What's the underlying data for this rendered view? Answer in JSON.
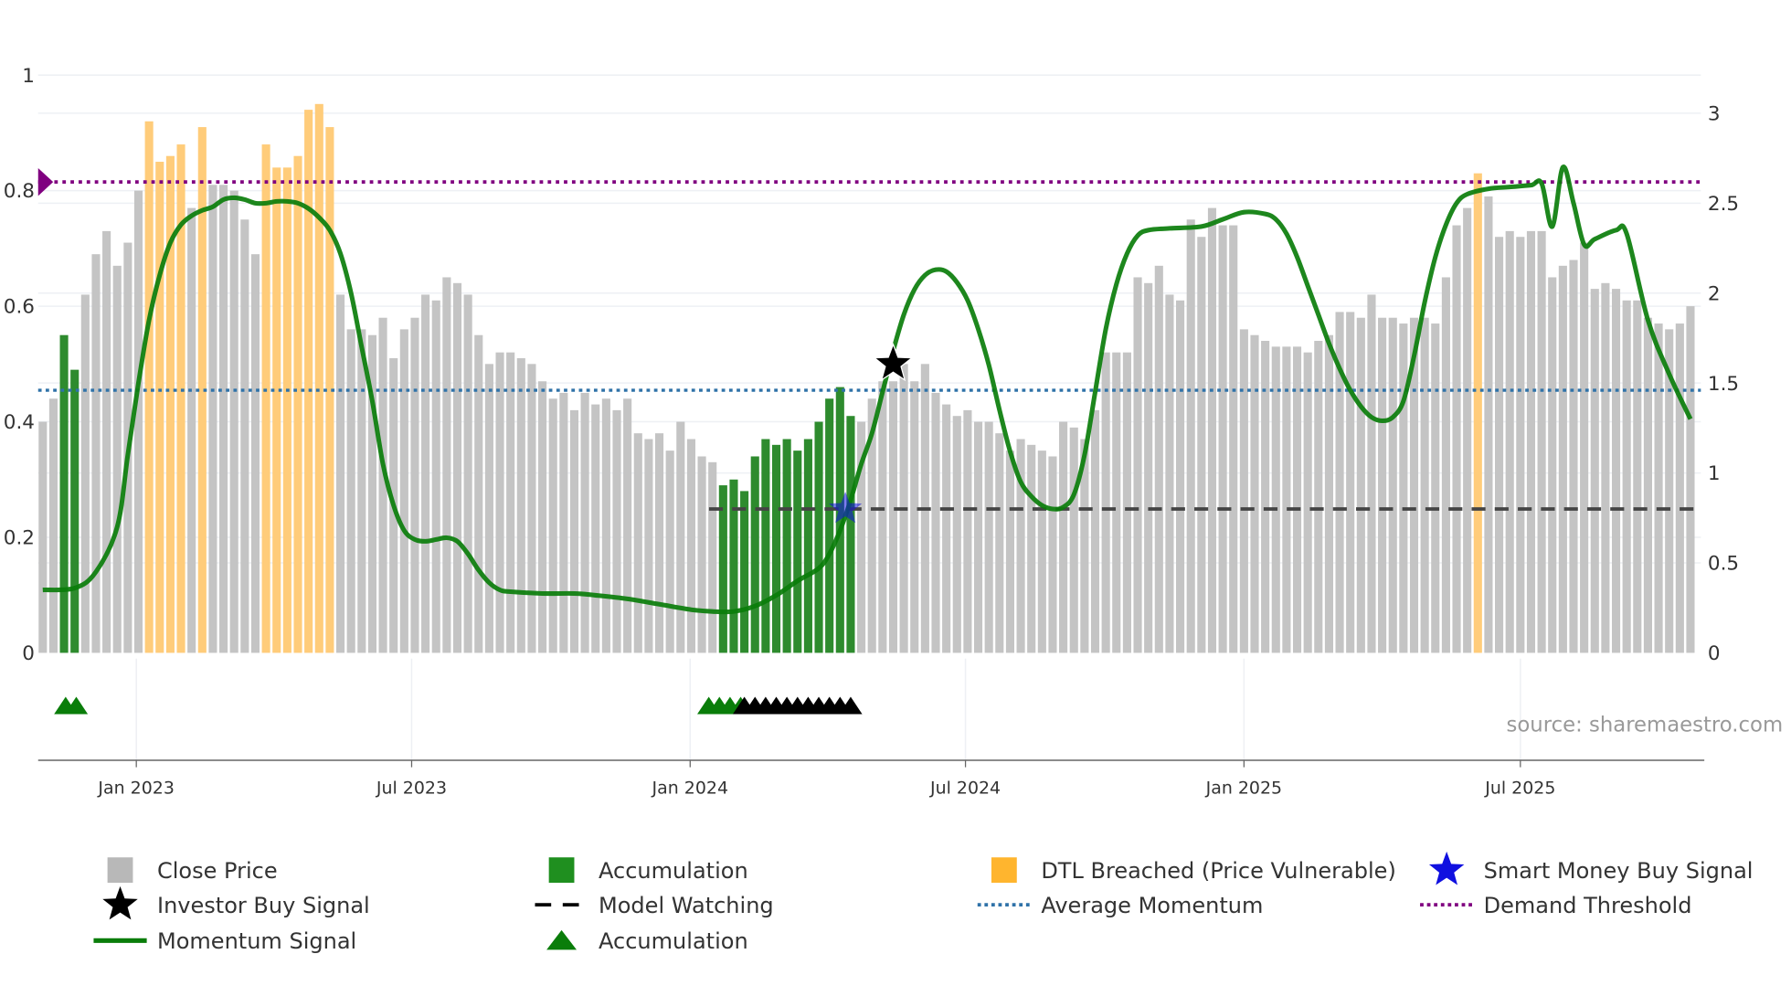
{
  "chart_data": {
    "type": "bar",
    "title": "",
    "x_unit": "week",
    "x_ticks": [
      {
        "label": "Jan 2023",
        "week": 8.8
      },
      {
        "label": "Jul 2023",
        "week": 34.7
      },
      {
        "label": "Jan 2024",
        "week": 60.9
      },
      {
        "label": "Jul 2024",
        "week": 86.8
      },
      {
        "label": "Jan 2025",
        "week": 113
      },
      {
        "label": "Jul 2025",
        "week": 139
      }
    ],
    "left_axis": {
      "ylim": [
        0,
        1
      ],
      "ticks": [
        "0",
        "0.2",
        "0.4",
        "0.6",
        "0.8",
        "1"
      ],
      "tick_values": [
        0,
        0.2,
        0.4,
        0.6,
        0.8,
        1
      ]
    },
    "right_axis": {
      "ylim": [
        0,
        3
      ],
      "ticks": [
        "0",
        "0.5",
        "1",
        "1.5",
        "2",
        "2.5",
        "3"
      ],
      "tick_values": [
        0,
        0.5,
        1,
        1.5,
        2,
        2.5,
        3
      ]
    },
    "close_price": [
      0.4,
      0.44,
      0.55,
      0.49,
      0.62,
      0.69,
      0.73,
      0.67,
      0.71,
      0.8,
      0.92,
      0.85,
      0.86,
      0.88,
      0.77,
      0.91,
      0.81,
      0.81,
      0.8,
      0.75,
      0.69,
      0.88,
      0.84,
      0.84,
      0.86,
      0.94,
      0.95,
      0.91,
      0.62,
      0.56,
      0.56,
      0.55,
      0.58,
      0.51,
      0.56,
      0.58,
      0.62,
      0.61,
      0.65,
      0.64,
      0.62,
      0.55,
      0.5,
      0.52,
      0.52,
      0.51,
      0.5,
      0.47,
      0.44,
      0.45,
      0.42,
      0.45,
      0.43,
      0.44,
      0.42,
      0.44,
      0.38,
      0.37,
      0.38,
      0.35,
      0.4,
      0.37,
      0.34,
      0.33,
      0.29,
      0.3,
      0.28,
      0.34,
      0.37,
      0.36,
      0.37,
      0.35,
      0.37,
      0.4,
      0.44,
      0.46,
      0.41,
      0.4,
      0.44,
      0.47,
      0.47,
      0.5,
      0.47,
      0.5,
      0.45,
      0.43,
      0.41,
      0.42,
      0.4,
      0.4,
      0.38,
      0.35,
      0.37,
      0.36,
      0.35,
      0.34,
      0.4,
      0.39,
      0.37,
      0.42,
      0.52,
      0.52,
      0.52,
      0.65,
      0.64,
      0.67,
      0.62,
      0.61,
      0.75,
      0.72,
      0.77,
      0.74,
      0.74,
      0.56,
      0.55,
      0.54,
      0.53,
      0.53,
      0.53,
      0.52,
      0.54,
      0.55,
      0.59,
      0.59,
      0.58,
      0.62,
      0.58,
      0.58,
      0.57,
      0.58,
      0.58,
      0.57,
      0.65,
      0.74,
      0.77,
      0.83,
      0.79,
      0.72,
      0.73,
      0.72,
      0.73,
      0.73,
      0.65,
      0.67,
      0.68,
      0.71,
      0.63,
      0.64,
      0.63,
      0.61,
      0.61,
      0.58,
      0.57,
      0.56,
      0.57,
      0.6
    ],
    "accumulation_weeks": [
      2,
      3,
      64,
      65,
      66,
      67,
      68,
      69,
      70,
      71,
      72,
      73,
      74,
      75,
      76
    ],
    "dtl_breached_weeks": [
      10,
      11,
      12,
      13,
      15,
      21,
      22,
      23,
      24,
      25,
      26,
      27,
      135
    ],
    "momentum_signal": [
      [
        0,
        0.35
      ],
      [
        3,
        0.36
      ],
      [
        5,
        0.45
      ],
      [
        7,
        0.7
      ],
      [
        8,
        1.1
      ],
      [
        9,
        1.5
      ],
      [
        10,
        1.85
      ],
      [
        11,
        2.1
      ],
      [
        12,
        2.28
      ],
      [
        13,
        2.38
      ],
      [
        14,
        2.43
      ],
      [
        15,
        2.46
      ],
      [
        16,
        2.48
      ],
      [
        17,
        2.52
      ],
      [
        18,
        2.53
      ],
      [
        19,
        2.52
      ],
      [
        20,
        2.5
      ],
      [
        21,
        2.5
      ],
      [
        22,
        2.51
      ],
      [
        23,
        2.51
      ],
      [
        24,
        2.5
      ],
      [
        25,
        2.47
      ],
      [
        26,
        2.42
      ],
      [
        27,
        2.35
      ],
      [
        28,
        2.22
      ],
      [
        29,
        2.0
      ],
      [
        30,
        1.7
      ],
      [
        31,
        1.4
      ],
      [
        32,
        1.05
      ],
      [
        33,
        0.82
      ],
      [
        34,
        0.68
      ],
      [
        35,
        0.63
      ],
      [
        36,
        0.62
      ],
      [
        37,
        0.63
      ],
      [
        38,
        0.64
      ],
      [
        39,
        0.62
      ],
      [
        40,
        0.55
      ],
      [
        41,
        0.46
      ],
      [
        42,
        0.39
      ],
      [
        43,
        0.35
      ],
      [
        44,
        0.34
      ],
      [
        47,
        0.33
      ],
      [
        50,
        0.33
      ],
      [
        52,
        0.32
      ],
      [
        55,
        0.3
      ],
      [
        58,
        0.27
      ],
      [
        61,
        0.24
      ],
      [
        63,
        0.23
      ],
      [
        65,
        0.23
      ],
      [
        67,
        0.26
      ],
      [
        69,
        0.32
      ],
      [
        71,
        0.4
      ],
      [
        73,
        0.47
      ],
      [
        74,
        0.55
      ],
      [
        75,
        0.68
      ],
      [
        76,
        0.85
      ],
      [
        77,
        1.05
      ],
      [
        78,
        1.22
      ],
      [
        79,
        1.45
      ],
      [
        80,
        1.68
      ],
      [
        81,
        1.88
      ],
      [
        82,
        2.02
      ],
      [
        83,
        2.1
      ],
      [
        84,
        2.13
      ],
      [
        85,
        2.12
      ],
      [
        86,
        2.06
      ],
      [
        87,
        1.96
      ],
      [
        88,
        1.8
      ],
      [
        89,
        1.6
      ],
      [
        90,
        1.35
      ],
      [
        91,
        1.12
      ],
      [
        92,
        0.95
      ],
      [
        93,
        0.87
      ],
      [
        94,
        0.82
      ],
      [
        95,
        0.8
      ],
      [
        96,
        0.81
      ],
      [
        97,
        0.88
      ],
      [
        98,
        1.1
      ],
      [
        99,
        1.45
      ],
      [
        100,
        1.8
      ],
      [
        101,
        2.05
      ],
      [
        102,
        2.22
      ],
      [
        103,
        2.32
      ],
      [
        104,
        2.35
      ],
      [
        106,
        2.36
      ],
      [
        109,
        2.37
      ],
      [
        111,
        2.41
      ],
      [
        113,
        2.45
      ],
      [
        115,
        2.44
      ],
      [
        116,
        2.41
      ],
      [
        117,
        2.33
      ],
      [
        118,
        2.2
      ],
      [
        119,
        2.04
      ],
      [
        120,
        1.88
      ],
      [
        121,
        1.72
      ],
      [
        122,
        1.58
      ],
      [
        123,
        1.46
      ],
      [
        124,
        1.37
      ],
      [
        125,
        1.31
      ],
      [
        126,
        1.29
      ],
      [
        127,
        1.31
      ],
      [
        128,
        1.4
      ],
      [
        129,
        1.65
      ],
      [
        130,
        1.95
      ],
      [
        131,
        2.2
      ],
      [
        132,
        2.38
      ],
      [
        133,
        2.5
      ],
      [
        134,
        2.55
      ],
      [
        136,
        2.58
      ],
      [
        138,
        2.59
      ],
      [
        140,
        2.6
      ],
      [
        141,
        2.61
      ],
      [
        142,
        2.37
      ],
      [
        143,
        2.7
      ],
      [
        144,
        2.5
      ],
      [
        145,
        2.27
      ],
      [
        146,
        2.3
      ],
      [
        148,
        2.35
      ],
      [
        149,
        2.33
      ],
      [
        151,
        1.85
      ],
      [
        153,
        1.55
      ],
      [
        155,
        1.3
      ]
    ],
    "average_momentum": 1.46,
    "demand_threshold": 0.815,
    "model_watching": {
      "value": 0.8,
      "from_week": 63
    },
    "investor_buy_signal": {
      "week": 80,
      "value": 0.5
    },
    "smart_money_buy_signal": {
      "week": 75.5,
      "value": 0.8
    },
    "accumulation_markers": {
      "green_weeks": [
        1.5,
        2.5,
        62,
        63,
        64,
        65
      ],
      "black_weeks": [
        66,
        67,
        68,
        69,
        70,
        71,
        72,
        73,
        74,
        75,
        76
      ]
    },
    "legend": {
      "close_price": "Close Price",
      "accumulation_bar": "Accumulation",
      "dtl_breached": "DTL Breached (Price Vulnerable)",
      "smart_money": "Smart Money Buy Signal",
      "investor_buy": "Investor Buy Signal",
      "model_watching": "Model Watching",
      "average_momentum": "Average Momentum",
      "demand_threshold": "Demand Threshold",
      "momentum_signal": "Momentum Signal",
      "accumulation_marker": "Accumulation"
    },
    "source": "source: sharemaestro.com"
  },
  "colors": {
    "gray": "#c4c4c4",
    "green": "#2e8b2e",
    "orange": "#ffcc7a",
    "line": "#0a7d0a",
    "purple": "#800080",
    "blue_dotted": "#2f72a8",
    "star_blue": "#1010e0"
  }
}
